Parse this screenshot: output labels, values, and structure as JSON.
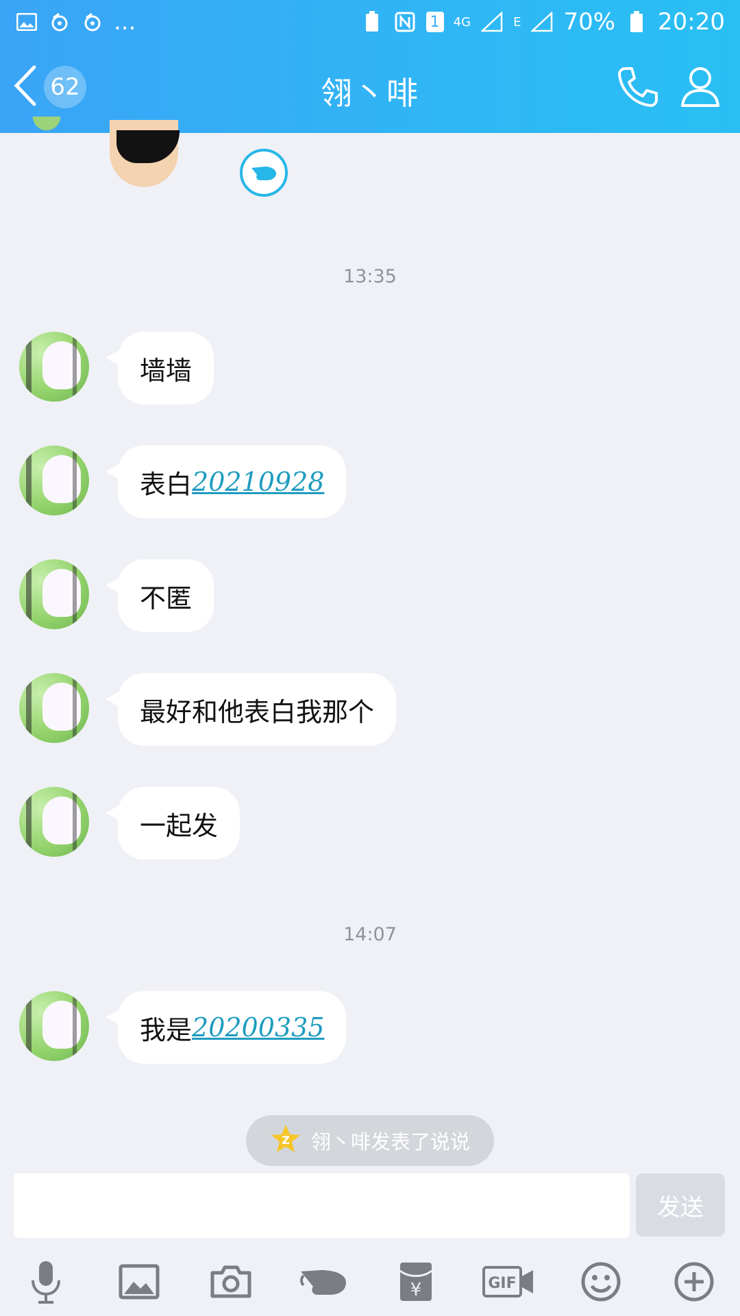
{
  "status_bar": {
    "left_more": "...",
    "network_4g": "4G",
    "network_e": "E",
    "sim_slot": "1",
    "battery": "70%",
    "time": "20:20"
  },
  "header": {
    "unread_count": "62",
    "title": "翎丶啡"
  },
  "messages": [
    {
      "time": "13:35"
    },
    {
      "text": "墙墙",
      "link": ""
    },
    {
      "text": "表白",
      "link": "20210928"
    },
    {
      "text": "不匿",
      "link": ""
    },
    {
      "text": "最好和他表白我那个",
      "link": ""
    },
    {
      "text": "一起发",
      "link": ""
    },
    {
      "time": "14:07"
    },
    {
      "text": "我是",
      "link": "20200335"
    }
  ],
  "notice": {
    "text": "翎丶啡发表了说说"
  },
  "input": {
    "placeholder": "",
    "send_label": "发送"
  },
  "toolbar_icons": [
    "microphone-icon",
    "image-icon",
    "camera-icon",
    "poke-icon",
    "red-packet-icon",
    "gif-icon",
    "emoji-icon",
    "plus-icon"
  ],
  "colors": {
    "header_gradient_start": "#3aa4f6",
    "header_gradient_end": "#29bff3",
    "link": "#1e9bbf",
    "background": "#eff1f6"
  }
}
